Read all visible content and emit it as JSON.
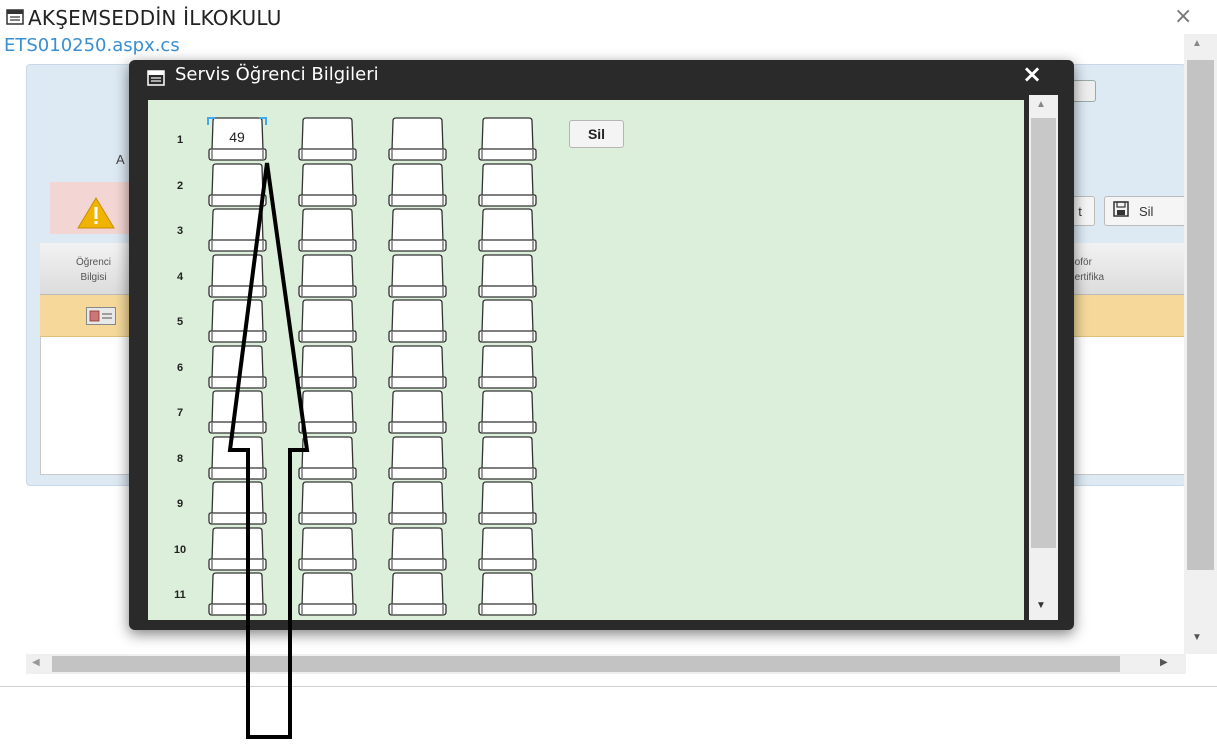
{
  "outer_window": {
    "title": "AKŞEMSEDDİN İLKOKULU",
    "subtitle": "ETS010250.aspx.cs",
    "close": "×"
  },
  "background_page": {
    "a_letter": "A",
    "t_button": "t",
    "sil_button": "Sil",
    "grid_header_left": "Öğrenci\nBilgisi",
    "grid_header_right": "Şoför\nSertifika"
  },
  "modal": {
    "title": "Servis Öğrenci Bilgileri",
    "close": "×",
    "sil_button": "Sil",
    "row_labels": [
      "1",
      "2",
      "3",
      "4",
      "5",
      "6",
      "7",
      "8",
      "9",
      "10",
      "11"
    ],
    "seats_per_row": 4,
    "seat_values": {
      "1-1": "49"
    },
    "selected_seat": "1-1"
  },
  "colors": {
    "modal_frame": "#2a2a2a",
    "modal_body": "#dcefda",
    "link_blue": "#3a8fd1",
    "selection": "#3fa9f5",
    "grid_row": "#f6d99a"
  }
}
